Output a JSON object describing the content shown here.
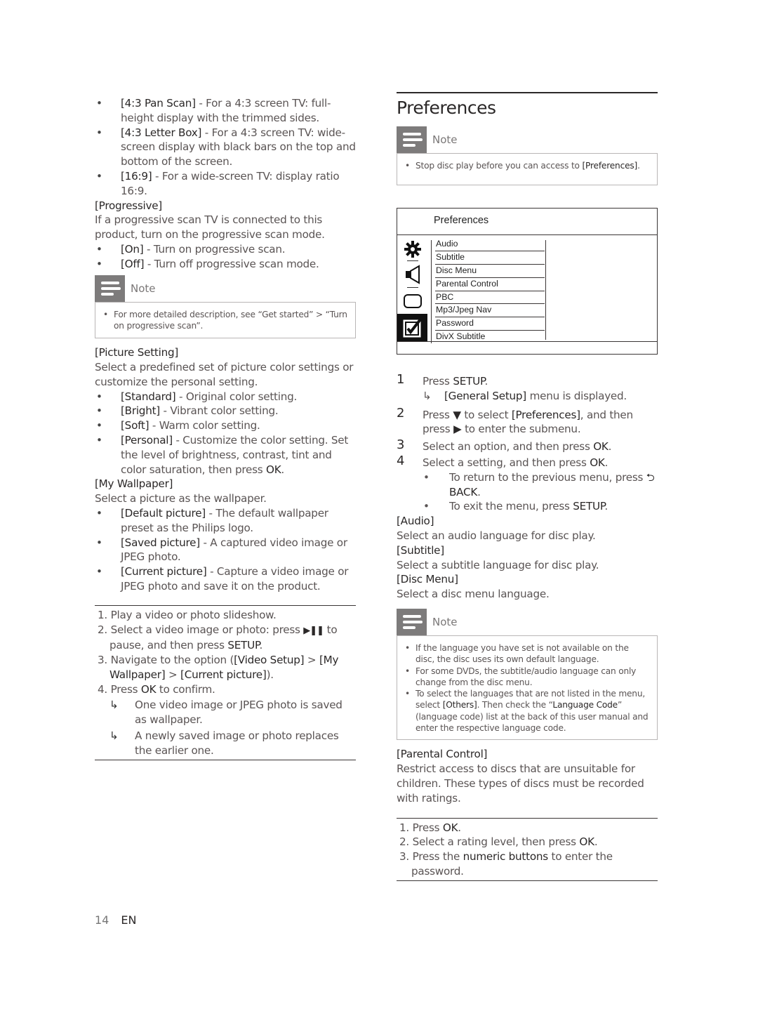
{
  "left": {
    "aspect_bullets": [
      {
        "term": "[4:3 Pan Scan]",
        "text": " - For a 4:3 screen TV: full-height display with the trimmed sides."
      },
      {
        "term": "[4:3 Letter Box]",
        "text": " - For a 4:3 screen TV: wide-screen display with black bars on the top and bottom of the screen."
      },
      {
        "term": "[16:9]",
        "text": " - For a wide-screen TV: display ratio 16:9."
      }
    ],
    "progressive": {
      "heading": "[Progressive]",
      "desc": "If a progressive scan TV is connected to this product, turn on the progressive scan mode.",
      "bullets": [
        {
          "term": "[On]",
          "text": " - Turn on progressive scan."
        },
        {
          "term": "[Off]",
          "text": " - Turn off progressive scan mode."
        }
      ]
    },
    "note1": {
      "label": "Note",
      "items": [
        "For more detailed description, see “Get started” > “Turn on progressive scan”."
      ]
    },
    "picture_setting": {
      "heading": "[Picture Setting]",
      "desc": "Select a predefined set of picture color settings or customize the personal setting.",
      "bullets": [
        {
          "term": "[Standard]",
          "text": " - Original color setting."
        },
        {
          "term": "[Bright]",
          "text": " - Vibrant color setting."
        },
        {
          "term": "[Soft]",
          "text": " - Warm color setting."
        },
        {
          "term": "[Personal]",
          "text": " - Customize the color setting. Set the level of brightness, contrast, tint and color saturation, then press ",
          "tail_bold": "OK",
          "tail": "."
        }
      ]
    },
    "wallpaper": {
      "heading": "[My Wallpaper]",
      "desc": "Select a picture as the wallpaper.",
      "bullets": [
        {
          "term": "[Default picture]",
          "text": " - The default wallpaper preset as the Philips logo."
        },
        {
          "term": "[Saved picture]",
          "text": " - A captured video image or JPEG photo."
        },
        {
          "term": "[Current picture]",
          "text": " - Capture a video image or JPEG photo and save it on the product."
        }
      ]
    },
    "procedure": {
      "step1": "1. Play a video or photo slideshow.",
      "step2_a": "2. Select a video image or photo: press ",
      "step2_icon": "play-pause",
      "step2_b": " to pause, and then press ",
      "step2_bold": "SETUP",
      "step2_c": ".",
      "step3_a": "3. Navigate to the option (",
      "step3_b1": "[Video Setup]",
      "step3_sep1": " > ",
      "step3_b2": "[My Wallpaper]",
      "step3_sep2": " > ",
      "step3_b3": "[Current picture]",
      "step3_c": ").",
      "step4_a": "4. Press ",
      "step4_bold": "OK",
      "step4_c": " to confirm.",
      "results": [
        "One video image or JPEG photo is saved as wallpaper.",
        "A newly saved image or photo replaces the earlier one."
      ]
    }
  },
  "right": {
    "title": "Preferences",
    "note1": {
      "label": "Note",
      "text": "Stop disc play before you can access to ",
      "bold": "[Preferences]",
      "tail": "."
    },
    "osd_menu": {
      "title": "Preferences",
      "icons": [
        "gear-icon",
        "speaker-icon",
        "screen-icon",
        "checkbox-icon"
      ],
      "selected_icon": "checkbox-icon",
      "items": [
        "Audio",
        "Subtitle",
        "Disc Menu",
        "Parental Control",
        "PBC",
        "Mp3/Jpeg Nav",
        "Password",
        "DivX Subtitle"
      ]
    },
    "steps": {
      "s1_num": "1",
      "s1_a": "Press ",
      "s1_bold": "SETUP",
      "s1_c": ".",
      "s1_res_bold": "[General Setup]",
      "s1_res": " menu is displayed.",
      "s2_num": "2",
      "s2_a": "Press ",
      "s2_b": " to select ",
      "s2_bold": "[Preferences]",
      "s2_c": ", and then press ",
      "s2_d": " to enter the submenu.",
      "s3_num": "3",
      "s3_a": "Select an option, and then press ",
      "s3_bold": "OK",
      "s3_c": ".",
      "s4_num": "4",
      "s4_a": "Select a setting, and then press ",
      "s4_bold": "OK",
      "s4_c": ".",
      "s4_b1": "To return to the previous menu, press ",
      "s4_b1_bold": "BACK",
      "s4_b1_c": ".",
      "s4_b2": "To exit the menu, press ",
      "s4_b2_bold": "SETUP",
      "s4_b2_c": "."
    },
    "audio": {
      "heading": "[Audio]",
      "desc": "Select an audio language for disc play."
    },
    "subtitle": {
      "heading": "[Subtitle]",
      "desc": "Select a subtitle language for disc play."
    },
    "disc_menu": {
      "heading": "[Disc Menu]",
      "desc": "Select a disc menu language."
    },
    "note2": {
      "label": "Note",
      "item1": "If the language you have set is not available on the disc, the disc uses its own default language.",
      "item2": "For some DVDs, the subtitle/audio language can only change from the disc menu.",
      "item3_a": "To select the languages that are not listed in the menu, select ",
      "item3_bold1": "[Others]",
      "item3_b": ". Then check the “",
      "item3_bold2": "Language Code",
      "item3_c": "” (language code) list at the back of this user manual and enter the respective language code."
    },
    "parental": {
      "heading": "[Parental Control]",
      "desc": "Restrict access to discs that are unsuitable for children. These types of discs must be recorded with ratings.",
      "p1_a": "1. Press ",
      "p1_bold": "OK",
      "p1_c": ".",
      "p2_a": "2. Select a rating level, then press ",
      "p2_bold": "OK",
      "p2_c": ".",
      "p3_a": "3. Press the ",
      "p3_bold": "numeric buttons",
      "p3_c": " to enter the password."
    }
  },
  "footer": {
    "page": "14",
    "lang": "EN"
  }
}
